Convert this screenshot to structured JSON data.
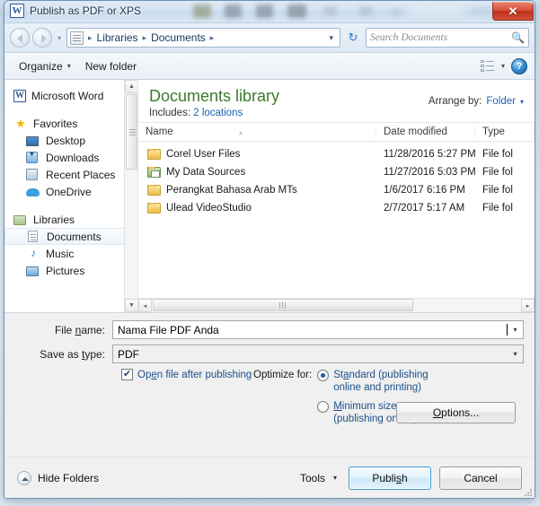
{
  "window": {
    "title": "Publish as PDF or XPS",
    "app_icon": "word-icon",
    "app_icon_letter": "W",
    "close_label": "✕"
  },
  "navbar": {
    "back_icon": "back-arrow-icon",
    "forward_icon": "forward-arrow-icon",
    "history_caret": "▾",
    "address_icon": "library-folder-icon",
    "breadcrumbs": [
      "Libraries",
      "Documents"
    ],
    "separator": "▸",
    "dropdown_caret": "▾",
    "refresh_icon": "↻",
    "search": {
      "placeholder": "Search Documents",
      "icon": "search-icon"
    }
  },
  "commandbar": {
    "organize_label": "Organize",
    "organize_caret": "▾",
    "new_folder_label": "New folder",
    "view_icon": "view-layout-icon",
    "view_caret": "▾",
    "help_icon": "help-icon",
    "help_label": "?"
  },
  "sidebar": {
    "items": [
      {
        "label": "Microsoft Word",
        "icon": "word-icon",
        "level": 0,
        "selected": false,
        "gap_after": true
      },
      {
        "label": "Favorites",
        "icon": "star-icon",
        "level": 0,
        "selected": false
      },
      {
        "label": "Desktop",
        "icon": "desktop-icon",
        "level": 1,
        "selected": false
      },
      {
        "label": "Downloads",
        "icon": "downloads-icon",
        "level": 1,
        "selected": false
      },
      {
        "label": "Recent Places",
        "icon": "recent-places-icon",
        "level": 1,
        "selected": false
      },
      {
        "label": "OneDrive",
        "icon": "cloud-icon",
        "level": 1,
        "selected": false,
        "gap_after": true
      },
      {
        "label": "Libraries",
        "icon": "libraries-icon",
        "level": 0,
        "selected": false
      },
      {
        "label": "Documents",
        "icon": "document-icon",
        "level": 1,
        "selected": true
      },
      {
        "label": "Music",
        "icon": "music-note-icon",
        "level": 1,
        "selected": false
      },
      {
        "label": "Pictures",
        "icon": "picture-icon",
        "level": 1,
        "selected": false
      }
    ],
    "scroll_up": "▲",
    "scroll_down": "▼"
  },
  "library": {
    "title": "Documents library",
    "includes_label": "Includes:",
    "includes_value": "2 locations",
    "arrange_label": "Arrange by:",
    "arrange_value": "Folder",
    "arrange_caret": "▾"
  },
  "filelist": {
    "columns": [
      "Name",
      "Date modified",
      "Type"
    ],
    "sort_arrow": "▴",
    "rows": [
      {
        "name": "Corel User Files",
        "date": "11/28/2016 5:27 PM",
        "type": "File fol",
        "icon": "folder-icon"
      },
      {
        "name": "My Data Sources",
        "date": "11/27/2016 5:03 PM",
        "type": "File fol",
        "icon": "special-folder-icon"
      },
      {
        "name": "Perangkat Bahasa Arab MTs",
        "date": "1/6/2017 6:16 PM",
        "type": "File fol",
        "icon": "folder-icon"
      },
      {
        "name": "Ulead VideoStudio",
        "date": "2/7/2017 5:17 AM",
        "type": "File fol",
        "icon": "folder-icon"
      }
    ],
    "hscroll_left": "◂",
    "hscroll_right": "▸"
  },
  "form": {
    "filename_label_pre": "File ",
    "filename_label_key": "n",
    "filename_label_post": "ame:",
    "filename_value": "Nama File PDF Anda",
    "savetype_label_pre": "Save as ",
    "savetype_label_key": "t",
    "savetype_label_post": "ype:",
    "savetype_value": "PDF",
    "combo_caret": "▾",
    "open_after_label_pre": "Op",
    "open_after_label_key": "e",
    "open_after_label_post": "n file after publishing",
    "open_after_checked": true,
    "check_glyph": "✔",
    "optimize_label": "Optimize for:",
    "radios": [
      {
        "line1_pre": "St",
        "line1_key": "a",
        "line1_post": "ndard (publishing",
        "line2": "online and printing)",
        "selected": true
      },
      {
        "line1_pre": "",
        "line1_key": "M",
        "line1_post": "inimum size",
        "line2": "(publishing online)",
        "selected": false
      }
    ],
    "options_button_pre": "",
    "options_button_key": "O",
    "options_button_post": "ptions..."
  },
  "footer": {
    "hide_folders_label": "Hide Folders",
    "hide_folders_icon": "collapse-up-icon",
    "tools_label": "Tools",
    "tools_caret": "▾",
    "publish_pre": "Publi",
    "publish_key": "s",
    "publish_post": "h",
    "cancel_label": "Cancel"
  },
  "colors": {
    "accent_blue": "#1a64b4",
    "library_green": "#3c7a2e",
    "close_red": "#bc2f1c",
    "primary_border": "#3c9cd4"
  }
}
